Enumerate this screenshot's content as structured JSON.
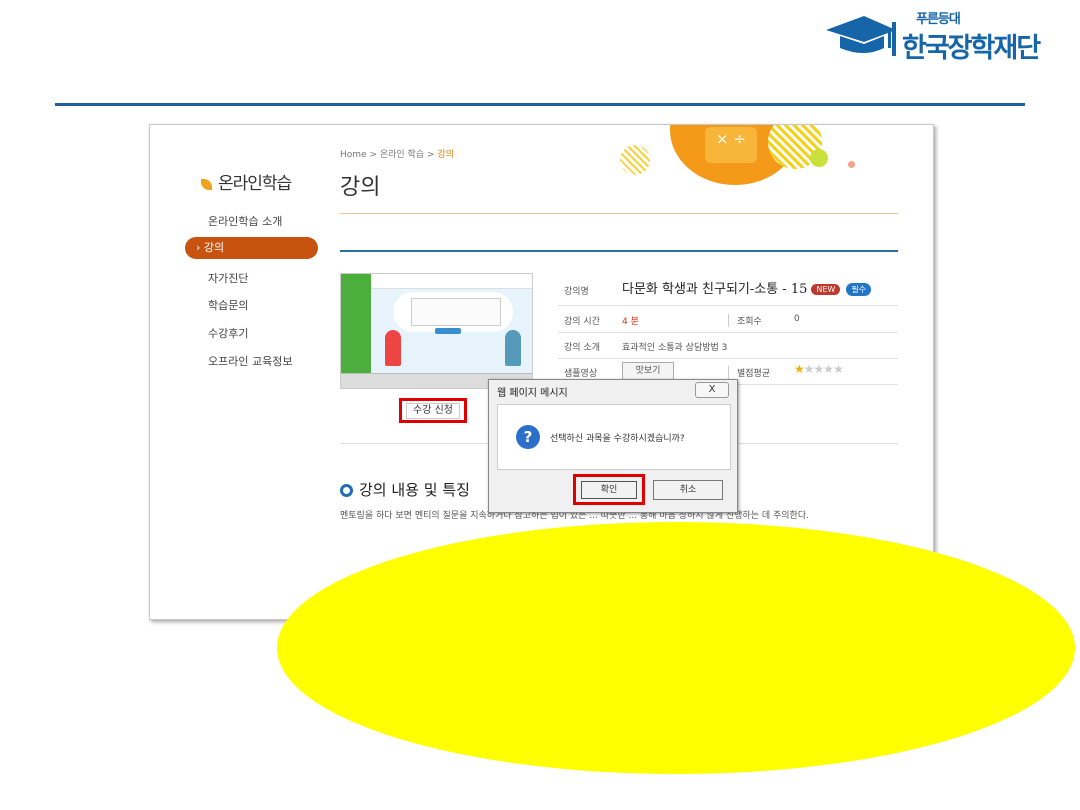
{
  "logo": {
    "small": "푸른등대",
    "big": "한국장학재단"
  },
  "sidebar": {
    "title": "온라인학습",
    "items": [
      {
        "label": "온라인학습 소개"
      },
      {
        "label": "› 강의"
      },
      {
        "label": "자가진단"
      },
      {
        "label": "학습문의"
      },
      {
        "label": "수강후기"
      },
      {
        "label": "오프라인 교육정보"
      }
    ]
  },
  "breadcrumb": {
    "home": "Home",
    "sep1": " > ",
    "level1": "온라인 학습",
    "sep2": " > ",
    "current": "강의"
  },
  "page_title": "강의",
  "deco_symbol": "× ÷",
  "course": {
    "title_label": "강의명",
    "title": "다문화 학생과 친구되기-소통 - 15",
    "badge_new": "NEW",
    "badge_required": "필수",
    "time_label": "강의 시간",
    "time_value": "4 분",
    "views_label": "조회수",
    "views_value": "0",
    "intro_label": "강의 소개",
    "intro_value": "효과적인 소통과 상담방법 3",
    "sample_label": "샘플영상",
    "preview_button": "맛보기",
    "rating_label": "별점평균",
    "rating": 1,
    "rating_max": 5
  },
  "apply_button": "수강 신청",
  "section": {
    "heading": "강의 내용 및 특징",
    "description": "멘토링을 하다 보면 멘티의 질문을 지속하거나 참고하는 법이 있는 ... 따뜻한 ... 통해 마음 상하지 않게 진행하는 데 주의한다."
  },
  "dialog": {
    "title": "웹 페이지 메시지",
    "close": "X",
    "message": "선택하신 과목을 수강하시겠습니까?",
    "ok": "확인",
    "cancel": "취소"
  },
  "colors": {
    "brand_blue": "#1565a8",
    "active_tab": "#c8520f",
    "highlight": "#ffff00",
    "emphasis_box": "#e00000"
  }
}
